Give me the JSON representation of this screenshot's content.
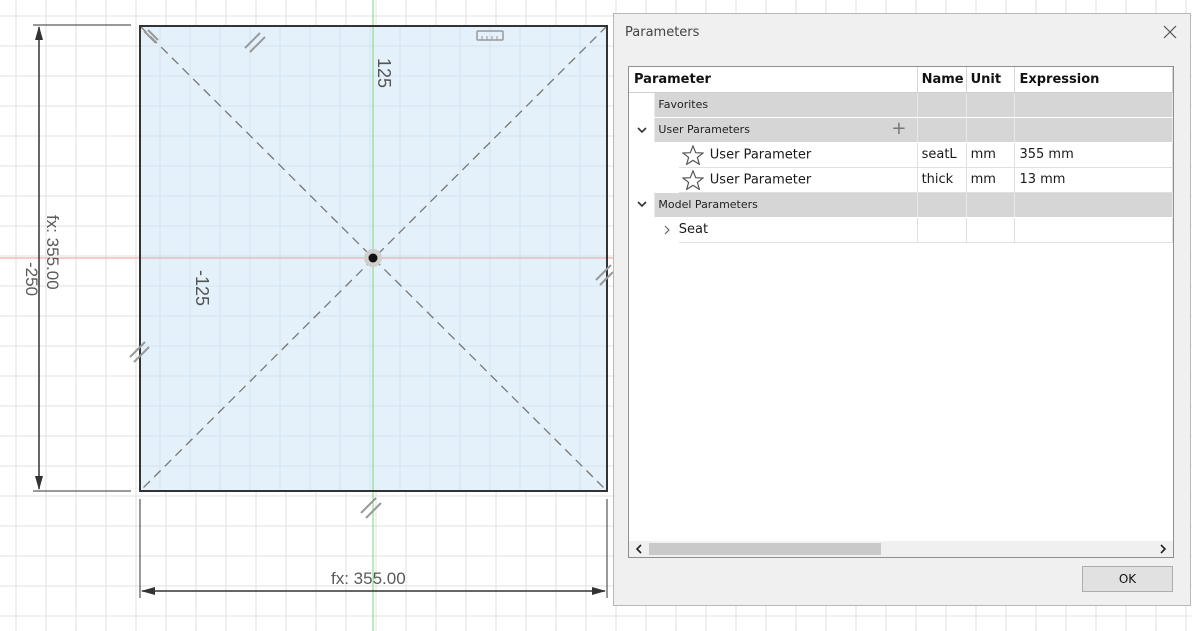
{
  "canvas": {
    "dimension_horizontal": "fx: 355.00",
    "dimension_vertical": "fx: 355.00",
    "dimension_vertical_sub": "-250",
    "label_top": "125",
    "label_left": "-125",
    "colors": {
      "grid": "#e2e2e2",
      "sketch_fill": "#e4f1fb",
      "x_axis": "#f29a9a",
      "y_axis": "#7fd17f",
      "profile_line": "#333333"
    }
  },
  "dialog": {
    "title": "Parameters",
    "close_icon": "close-icon",
    "columns": {
      "parameter": "Parameter",
      "name": "Name",
      "unit": "Unit",
      "expression": "Expression"
    },
    "favorites_label": "Favorites",
    "user_group_label": "User Parameters",
    "add_icon": "plus-icon",
    "user_parameters": [
      {
        "label": "User Parameter",
        "name": "seatL",
        "unit": "mm",
        "expression": "355 mm"
      },
      {
        "label": "User Parameter",
        "name": "thick",
        "unit": "mm",
        "expression": "13 mm"
      }
    ],
    "model_group_label": "Model Parameters",
    "model_children": [
      {
        "label": "Seat"
      }
    ],
    "ok_label": "OK"
  }
}
